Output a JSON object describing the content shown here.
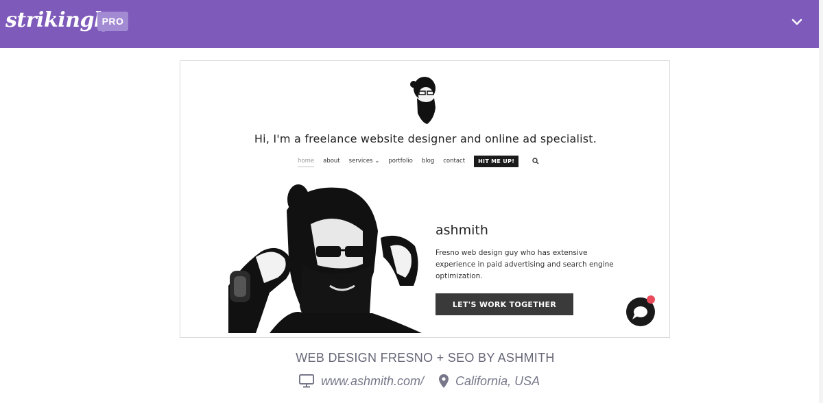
{
  "header": {
    "logo_text": "strikingly",
    "badge": "PRO",
    "menu_icon": "chevron-down-icon",
    "background_color": "#7e5bbb"
  },
  "preview": {
    "headline": "Hi, I'm a freelance website designer and online ad specialist.",
    "nav": {
      "items": [
        "home",
        "about",
        "services ⌄",
        "portfolio",
        "blog",
        "contact"
      ],
      "active": "home",
      "cta": "HIT ME UP!",
      "search_icon": "search-icon"
    },
    "profile": {
      "name": "ashmith",
      "bio": "Fresno web design guy who has extensive experience in paid advertising and search engine optimization.",
      "cta": "LET'S WORK TOGETHER"
    },
    "chat_icon": "chat-bubble-icon",
    "notification_color": "#e94b5b"
  },
  "caption": {
    "title": "WEB DESIGN FRESNO + SEO BY ASHMITH",
    "url": "www.ashmith.com/",
    "location": "California, USA",
    "url_icon": "monitor-icon",
    "location_icon": "location-pin-icon"
  }
}
